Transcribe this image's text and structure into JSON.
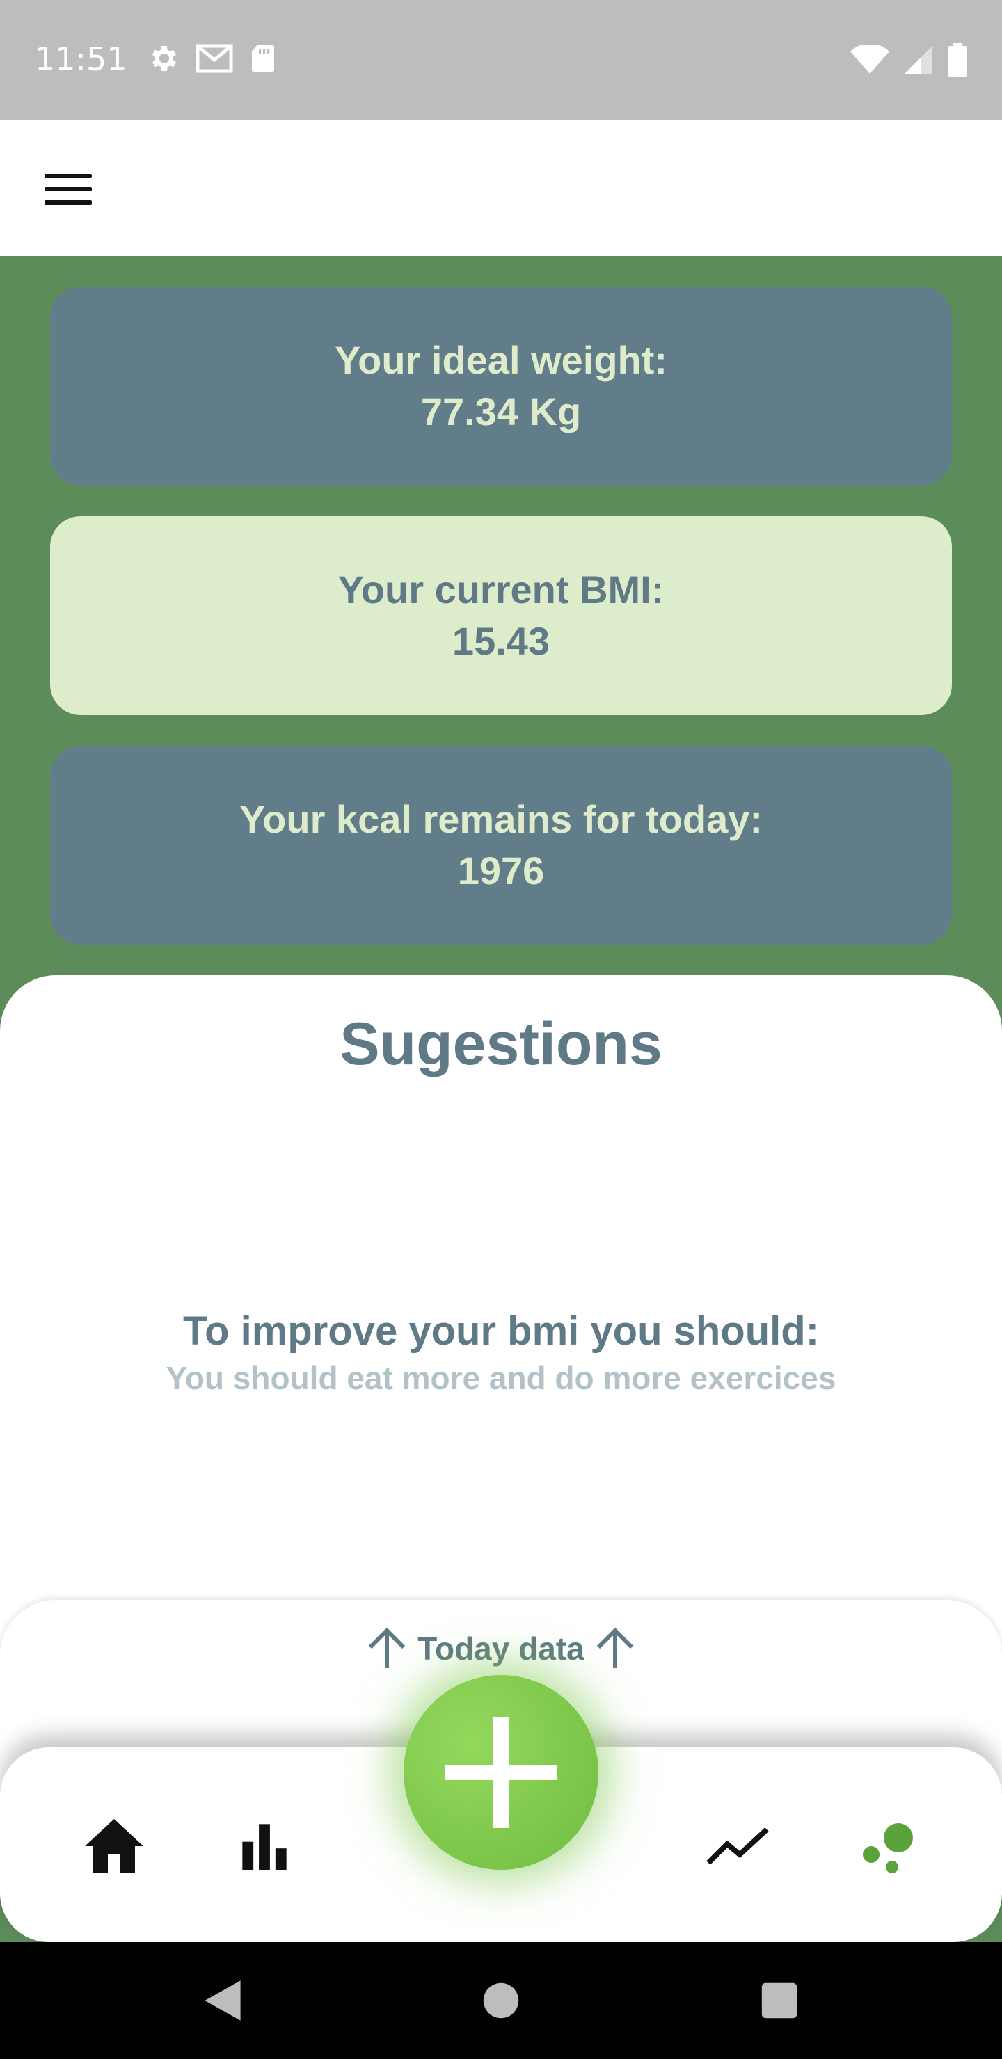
{
  "status_bar": {
    "time": "11:51",
    "left_icons": [
      "settings-icon",
      "gmail-icon",
      "sd-card-icon"
    ],
    "right_icons": [
      "wifi-icon",
      "signal-icon",
      "battery-icon"
    ]
  },
  "app_bar": {
    "menu_icon": "menu-icon"
  },
  "cards": {
    "ideal_weight": {
      "label": "Your ideal weight:",
      "value": "77.34 Kg"
    },
    "current_bmi": {
      "label": "Your current BMI:",
      "value": "15.43"
    },
    "kcal_remains": {
      "label": "Your kcal remains for today:",
      "value": "1976"
    }
  },
  "suggestions": {
    "title": "Sugestions",
    "heading": "To improve your bmi you should:",
    "text": "You should eat more and do more exercices"
  },
  "today_sheet": {
    "label": "Today data"
  },
  "bottom_nav": {
    "items": [
      "home-icon",
      "bar-chart-icon",
      "trend-icon",
      "bubbles-icon"
    ],
    "fab_icon": "plus-icon"
  },
  "colors": {
    "background_green": "#5d8c5b",
    "card_blue": "#627d8a",
    "card_green": "#ddeccb",
    "accent_green": "#70bd41",
    "text_slate": "#5f7a86"
  },
  "system_nav": [
    "back-icon",
    "home-circle-icon",
    "recents-icon"
  ]
}
